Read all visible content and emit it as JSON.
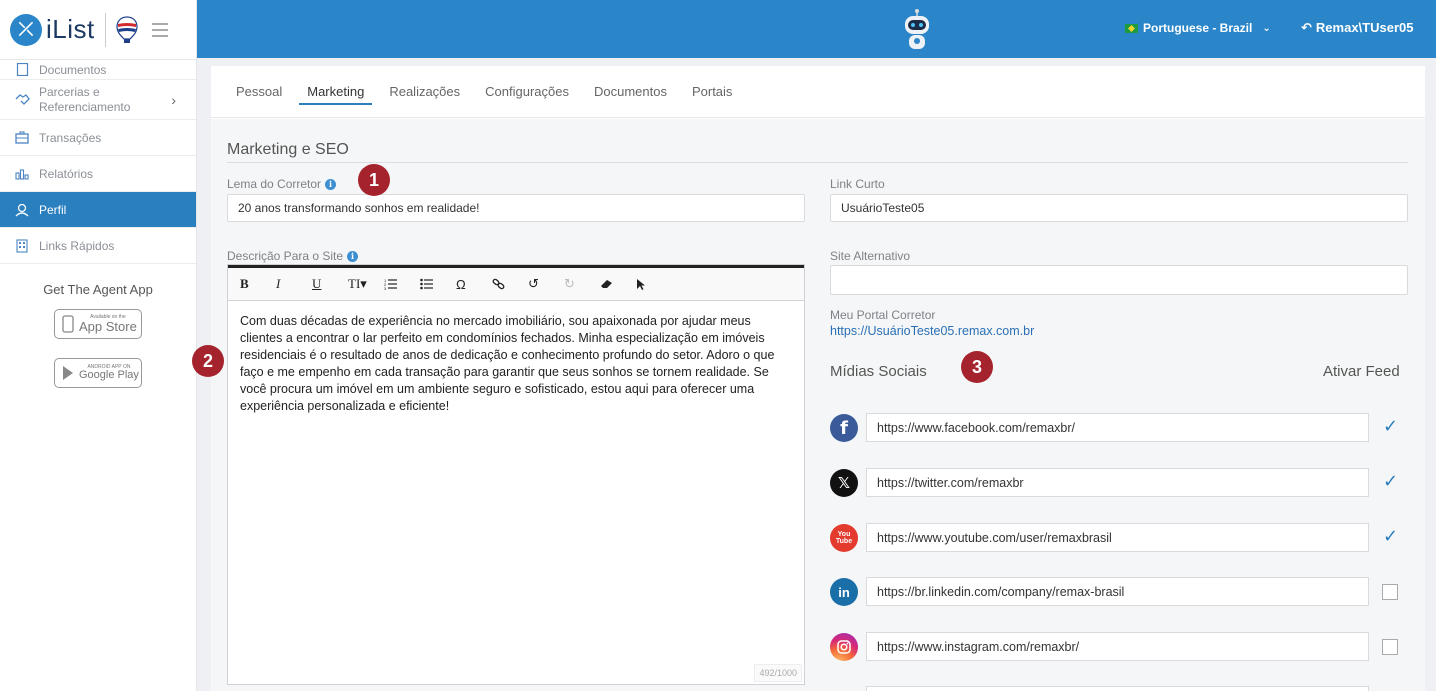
{
  "brand": {
    "logo_text": "iList"
  },
  "sidebar": {
    "items": [
      {
        "label": "Documentos",
        "icon": "document-icon"
      },
      {
        "label_line1": "Parcerias e",
        "label_line2": "Referenciamento",
        "icon": "handshake-icon"
      },
      {
        "label": "Transações",
        "icon": "briefcase-icon"
      },
      {
        "label": "Relatórios",
        "icon": "bar-chart-icon"
      },
      {
        "label": "Perfil",
        "icon": "user-icon",
        "active": true
      },
      {
        "label": "Links Rápidos",
        "icon": "building-icon"
      }
    ],
    "agent_app": "Get The Agent App",
    "app_store": {
      "small": "Available on the",
      "big": "App Store"
    },
    "google_play": {
      "small": "ANDROID APP ON",
      "big": "Google Play"
    }
  },
  "topbar": {
    "language": "Portuguese - Brazil",
    "user": "Remax\\TUser05",
    "accent": "#2a86c9"
  },
  "tabs": [
    "Pessoal",
    "Marketing",
    "Realizações",
    "Configurações",
    "Documentos",
    "Portais"
  ],
  "active_tab": "Marketing",
  "section_title": "Marketing e SEO",
  "fields": {
    "motto_label": "Lema do Corretor",
    "motto_value": "20 anos transformando sonhos em realidade!",
    "description_label": "Descrição Para o Site",
    "description_value": "Com duas décadas de experiência no mercado imobiliário, sou apaixonada por ajudar meus clientes a encontrar o lar perfeito em condomínios fechados. Minha especialização em imóveis residenciais é o resultado de anos de dedicação e conhecimento profundo do setor. Adoro o que faço e me empenho em cada transação para garantir que seus sonhos se tornem realidade. Se você procura um imóvel em um ambiente seguro e sofisticado, estou aqui para oferecer uma experiência personalizada e eficiente!",
    "char_counter": "492/1000",
    "short_link_label": "Link Curto",
    "short_link_value": "UsuárioTeste05",
    "alt_site_label": "Site Alternativo",
    "alt_site_value": "",
    "portal_label": "Meu Portal Corretor",
    "portal_url": "https://UsuárioTeste05.remax.com.br"
  },
  "editor_toolbar": [
    "bold",
    "italic",
    "underline",
    "text-size",
    "ordered-list",
    "unordered-list",
    "special-char",
    "link",
    "undo",
    "redo",
    "eraser",
    "pointer"
  ],
  "social": {
    "title": "Mídias Sociais",
    "feed_title": "Ativar Feed",
    "items": [
      {
        "network": "facebook",
        "url": "https://www.facebook.com/remaxbr/",
        "feed": true
      },
      {
        "network": "x",
        "url": "https://twitter.com/remaxbr",
        "feed": true
      },
      {
        "network": "youtube",
        "url": "https://www.youtube.com/user/remaxbrasil",
        "feed": true
      },
      {
        "network": "linkedin",
        "url": "https://br.linkedin.com/company/remax-brasil",
        "feed": false
      },
      {
        "network": "instagram",
        "url": "https://www.instagram.com/remaxbr/",
        "feed": false
      }
    ]
  },
  "badges": [
    "1",
    "2",
    "3"
  ]
}
